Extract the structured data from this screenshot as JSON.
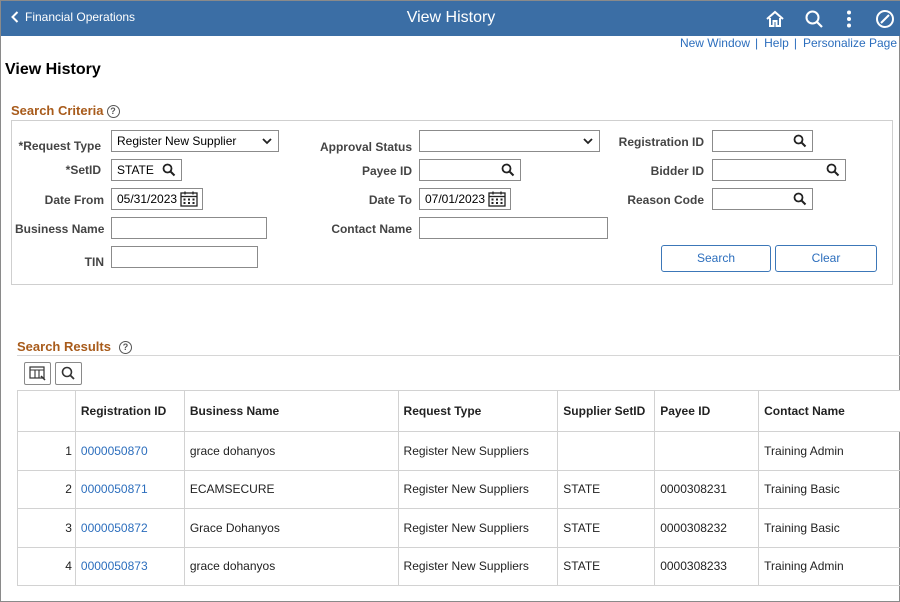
{
  "header": {
    "back_label": "Financial Operations",
    "title": "View History",
    "icons": [
      "home-icon",
      "search-icon",
      "more-icon",
      "navbar-icon"
    ]
  },
  "links": {
    "new_window": "New Window",
    "help": "Help",
    "personalize": "Personalize Page"
  },
  "page_title": "View History",
  "criteria": {
    "title": "Search Criteria",
    "request_type": {
      "label": "*Request Type",
      "value": "Register New Supplier"
    },
    "setid": {
      "label": "*SetID",
      "value": "STATE"
    },
    "date_from": {
      "label": "Date From",
      "value": "05/31/2023"
    },
    "business_name": {
      "label": "Business Name",
      "value": ""
    },
    "tin": {
      "label": "TIN",
      "value": ""
    },
    "approval_status": {
      "label": "Approval Status",
      "value": ""
    },
    "payee_id": {
      "label": "Payee ID",
      "value": ""
    },
    "date_to": {
      "label": "Date To",
      "value": "07/01/2023"
    },
    "contact_name": {
      "label": "Contact Name",
      "value": ""
    },
    "registration_id": {
      "label": "Registration ID",
      "value": ""
    },
    "bidder_id": {
      "label": "Bidder ID",
      "value": ""
    },
    "reason_code": {
      "label": "Reason Code",
      "value": ""
    },
    "search_label": "Search",
    "clear_label": "Clear"
  },
  "results": {
    "title": "Search Results",
    "columns": [
      "Registration ID",
      "Business Name",
      "Request Type",
      "Supplier SetID",
      "Payee ID",
      "Contact Name"
    ],
    "rows": [
      {
        "num": "1",
        "registration_id": "0000050870",
        "business_name": "grace dohanyos",
        "request_type": "Register New Suppliers",
        "supplier_setid": "",
        "payee_id": "",
        "contact_name": "Training Admin"
      },
      {
        "num": "2",
        "registration_id": "0000050871",
        "business_name": "ECAMSECURE",
        "request_type": "Register New Suppliers",
        "supplier_setid": "STATE",
        "payee_id": "0000308231",
        "contact_name": "Training Basic"
      },
      {
        "num": "3",
        "registration_id": "0000050872",
        "business_name": "Grace Dohanyos",
        "request_type": "Register New Suppliers",
        "supplier_setid": "STATE",
        "payee_id": "0000308232",
        "contact_name": "Training Basic"
      },
      {
        "num": "4",
        "registration_id": "0000050873",
        "business_name": "grace dohanyos",
        "request_type": "Register New Suppliers",
        "supplier_setid": "STATE",
        "payee_id": "0000308233",
        "contact_name": "Training Admin"
      }
    ]
  },
  "colors": {
    "header_bg": "#3b6ea5",
    "link": "#2c6ebd",
    "section_title": "#a85b1b"
  }
}
